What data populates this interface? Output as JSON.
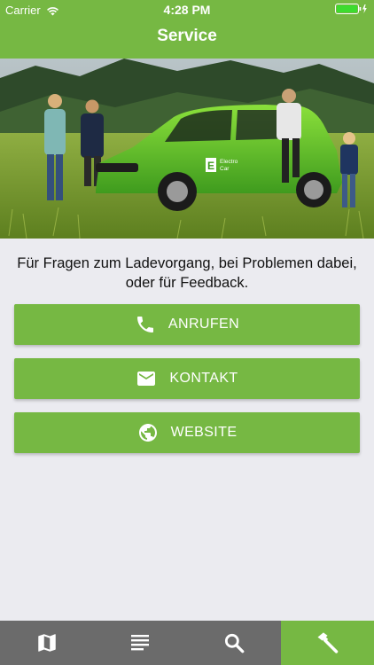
{
  "status": {
    "carrier": "Carrier",
    "time": "4:28 PM"
  },
  "nav": {
    "title": "Service"
  },
  "hero": {
    "car_brand_line1": "Electro",
    "car_brand_line2": "Car",
    "car_letter": "E"
  },
  "info_text": "Für Fragen zum Ladevorgang, bei Problemen dabei, oder für Feedback.",
  "actions": [
    {
      "label": "ANRUFEN",
      "icon": "phone-icon"
    },
    {
      "label": "KONTAKT",
      "icon": "mail-icon"
    },
    {
      "label": "WEBSITE",
      "icon": "globe-icon"
    }
  ],
  "tabs": [
    {
      "icon": "map-icon",
      "active": false
    },
    {
      "icon": "list-icon",
      "active": false
    },
    {
      "icon": "search-icon",
      "active": false
    },
    {
      "icon": "hammer-icon",
      "active": true
    }
  ],
  "colors": {
    "brand": "#76b843",
    "tabbar": "#6b6b6b",
    "background": "#ebebf0"
  }
}
